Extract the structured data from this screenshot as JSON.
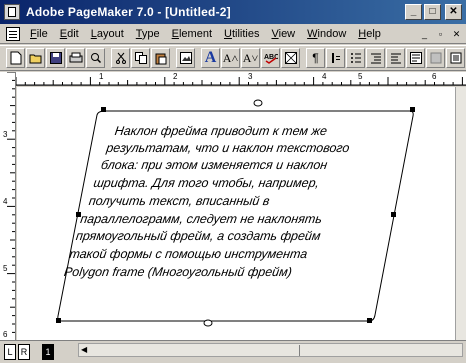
{
  "window": {
    "title": "Adobe PageMaker 7.0 - [Untitled-2]",
    "buttons": {
      "minimize": "_",
      "maximize": "□",
      "close": "✕"
    }
  },
  "menu": {
    "items": [
      "File",
      "Edit",
      "Layout",
      "Type",
      "Element",
      "Utilities",
      "View",
      "Window",
      "Help"
    ],
    "doc_buttons": [
      "_",
      "▫",
      "✕"
    ]
  },
  "toolbar": {
    "icons": [
      "new-icon",
      "open-icon",
      "save-icon",
      "print-icon",
      "find-icon",
      "spell-icon",
      "cut-icon",
      "copy-icon",
      "paste-icon",
      "undo-icon",
      "place-icon",
      "text-a-icon",
      "increase-font-icon",
      "decrease-font-icon",
      "spellcheck-icon",
      "frame-icon",
      "paragraph-icon",
      "bold-icon",
      "bullet-icon",
      "indent-icon",
      "outdent-icon",
      "style-icon",
      "link-icon",
      "layer-icon"
    ],
    "glyph_big_a": "A",
    "glyph_a_up": "A˄",
    "glyph_a_down": "A˅",
    "glyph_para": "¶"
  },
  "rulers": {
    "horizontal_labels": [
      "1",
      "2",
      "3",
      "4",
      "5",
      "6"
    ],
    "vertical_labels": [
      "3",
      "4",
      "5",
      "6"
    ]
  },
  "frame": {
    "lines": [
      "Наклон фрейма приводит к тем же",
      "результатам, что и наклон текстового",
      "блока: при этом изменяется и наклон",
      "шрифта. Для того чтобы, например,",
      "получить текст, вписанный в",
      "параллелограмм, следует не наклонять",
      "прямоугольный фрейм, а создать фрейм",
      "такой формы с помощью инструмента",
      "Polygon frame (Многоугольный фрейм)"
    ]
  },
  "pages": {
    "left": "L",
    "right": "R",
    "current": "1"
  }
}
